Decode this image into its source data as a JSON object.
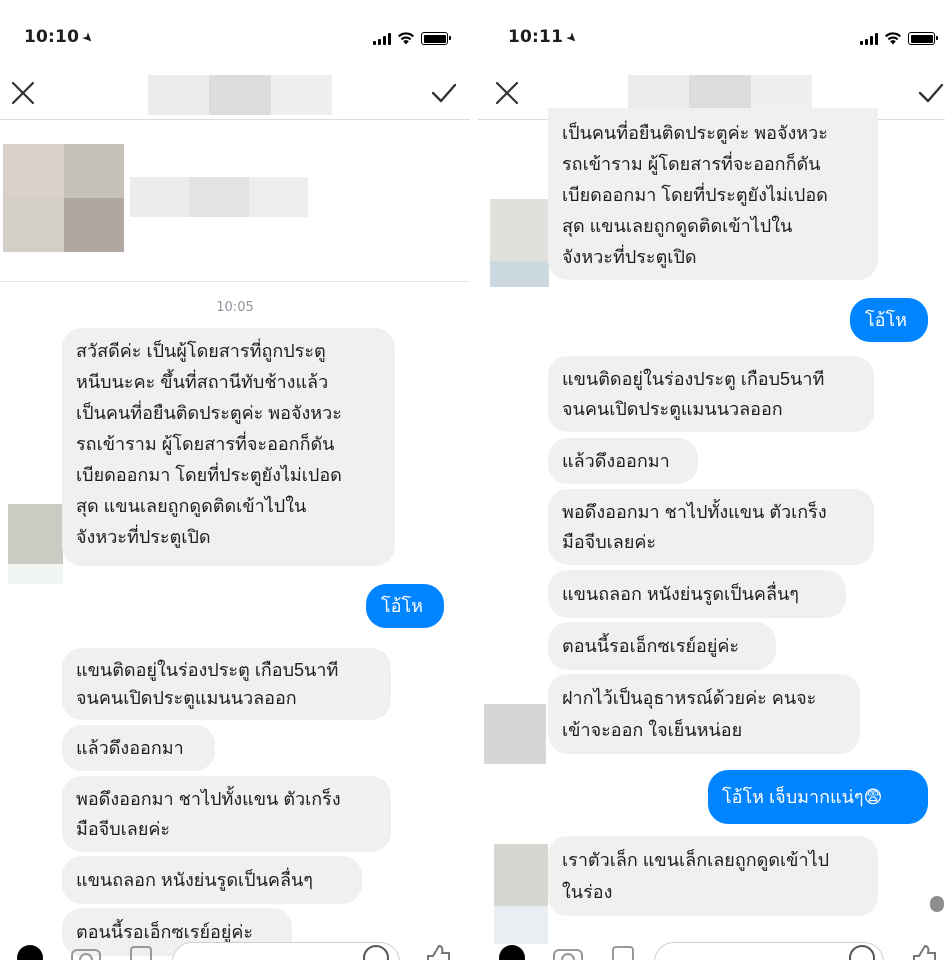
{
  "left": {
    "status": {
      "time": "10:10"
    },
    "timestamp": "10:05",
    "messages": [
      {
        "from": "them",
        "text": "สวัสดีค่ะ เป็นผู้โดยสารที่ถูกประตู\nหนีบนะคะ ขึ้นที่สถานีทับช้างแล้ว\nเป็นคนที่อยืนติดประตูค่ะ พอจังหวะ\nรถเข้าราม ผู้โดยสารที่จะออกก็ดัน\nเบียดออกมา โดยที่ประตูยังไม่เปอด\nสุด แขนเลยถูกดูดติดเข้าไปใน\nจังหวะที่ประตูเปิด"
      },
      {
        "from": "me",
        "text": "โอ้โห"
      },
      {
        "from": "them",
        "text": "แขนติดอยู่ในร่องประตู เกือบ5นาที\nจนคนเปิดประตูแมนนวลออก"
      },
      {
        "from": "them",
        "text": "แล้วดึงออกมา"
      },
      {
        "from": "them",
        "text": "พอดึงออกมา ชาไปทั้งแขน ตัวเกร็ง\nมือจีบเลยค่ะ"
      },
      {
        "from": "them",
        "text": "แขนถลอก หนังย่นรูดเป็นคลื่นๆ"
      },
      {
        "from": "them",
        "text": "ตอนนี้รอเอ็กซเรย์อยู่ค่ะ"
      }
    ]
  },
  "right": {
    "status": {
      "time": "10:11"
    },
    "messages": [
      {
        "from": "them",
        "text": "เป็นคนที่อยืนติดประตูค่ะ พอจังหวะ\nรถเข้าราม ผู้โดยสารที่จะออกก็ดัน\nเบียดออกมา โดยที่ประตูยังไม่เปอด\nสุด แขนเลยถูกดูดติดเข้าไปใน\nจังหวะที่ประตูเปิด"
      },
      {
        "from": "me",
        "text": "โอ้โห"
      },
      {
        "from": "them",
        "text": "แขนติดอยู่ในร่องประตู เกือบ5นาที\nจนคนเปิดประตูแมนนวลออก"
      },
      {
        "from": "them",
        "text": "แล้วดึงออกมา"
      },
      {
        "from": "them",
        "text": "พอดึงออกมา ชาไปทั้งแขน ตัวเกร็ง\nมือจีบเลยค่ะ"
      },
      {
        "from": "them",
        "text": "แขนถลอก หนังย่นรูดเป็นคลื่นๆ"
      },
      {
        "from": "them",
        "text": "ตอนนี้รอเอ็กซเรย์อยู่ค่ะ"
      },
      {
        "from": "them",
        "text": "ฝากไว้เป็นอุธาหรณ์ด้วยค่ะ คนจะ\nเข้าจะออก ใจเย็นหน่อย"
      },
      {
        "from": "me",
        "text": "โอ้โห เจ็บมากแน่ๆ😨"
      },
      {
        "from": "them",
        "text": "เราตัวเล็ก แขนเล็กเลยถูกดูดเข้าไป\nในร่อง"
      }
    ]
  },
  "icons": {
    "close": "close-icon",
    "check": "checkmark-icon",
    "battery": "battery-icon",
    "wifi": "wifi-icon",
    "signal": "cellular-signal-icon",
    "location": "location-arrow-icon"
  },
  "colors": {
    "outgoing_bubble": "#0084ff",
    "incoming_bubble": "#f1f0f0",
    "timestamp_text": "#90949c"
  }
}
